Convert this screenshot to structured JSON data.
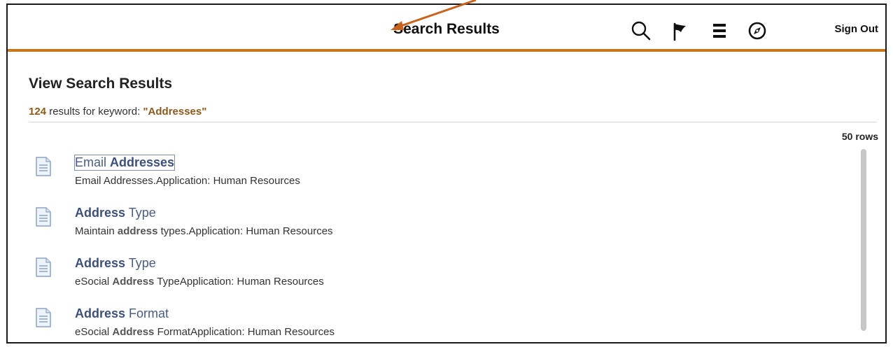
{
  "header": {
    "title": "Search Results",
    "sign_out_label": "Sign Out",
    "icons": [
      "search-icon",
      "flag-icon",
      "menu-icon",
      "compass-icon"
    ],
    "accent_color": "#c8781c"
  },
  "main": {
    "heading": "View Search Results",
    "summary": {
      "count": "124",
      "text": " results for keyword: ",
      "keyword": "\"Addresses\""
    },
    "rows_label": "50 rows"
  },
  "results": [
    {
      "title_prefix": "Email ",
      "title_bold": "Addresses",
      "title_suffix": "",
      "desc_prefix": "Email Addresses.Application: Human Resources",
      "desc_bold": "",
      "desc_suffix": ""
    },
    {
      "title_prefix": "",
      "title_bold": "Address",
      "title_suffix": " Type",
      "desc_prefix": "Maintain ",
      "desc_bold": "address",
      "desc_suffix": " types.Application: Human Resources"
    },
    {
      "title_prefix": "",
      "title_bold": "Address",
      "title_suffix": " Type",
      "desc_prefix": "eSocial ",
      "desc_bold": "Address",
      "desc_suffix": " TypeApplication: Human Resources"
    },
    {
      "title_prefix": "",
      "title_bold": "Address",
      "title_suffix": " Format",
      "desc_prefix": "eSocial ",
      "desc_bold": "Address",
      "desc_suffix": " FormatApplication: Human Resources"
    }
  ]
}
